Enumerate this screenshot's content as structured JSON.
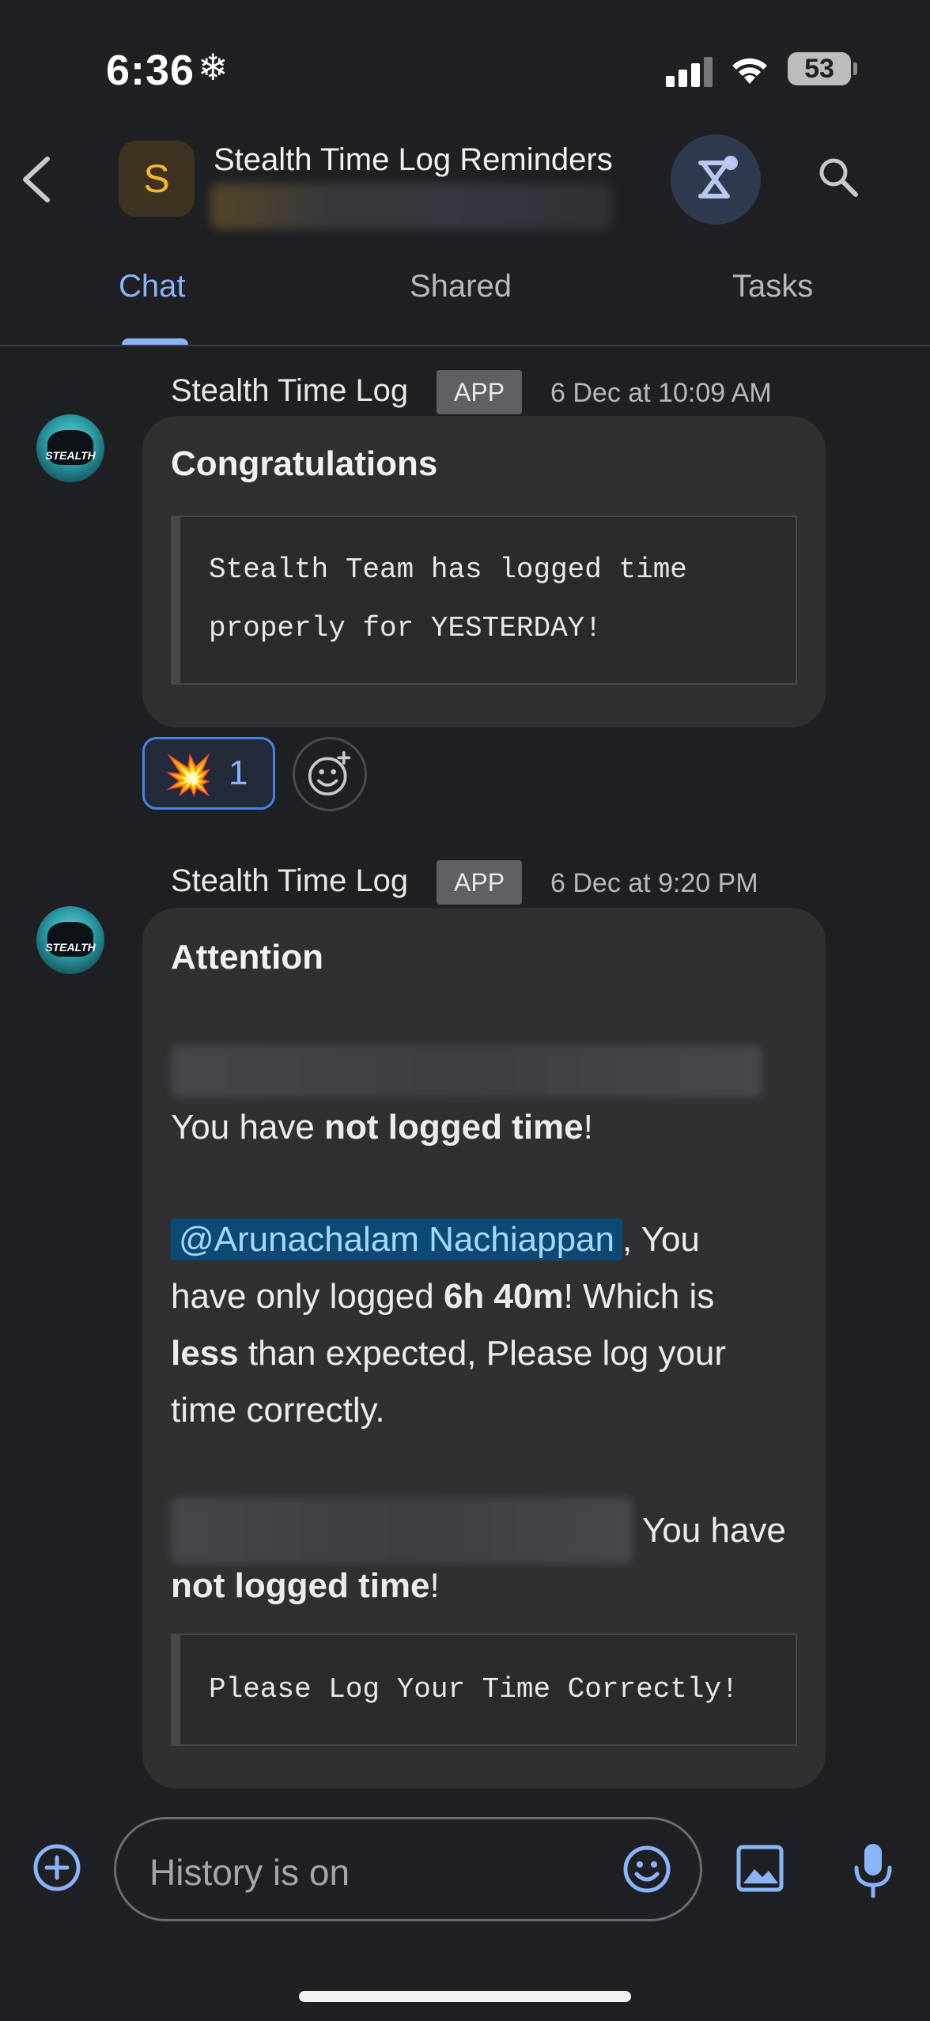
{
  "status_bar": {
    "time": "6:36",
    "weather_glyph": "❄",
    "battery": "53"
  },
  "header": {
    "space_initial": "S",
    "title": "Stealth Time Log Reminders",
    "back_icon": "chevron-left-icon",
    "app_icon": "integration-icon",
    "search_icon": "search-icon"
  },
  "tabs": [
    {
      "label": "Chat",
      "active": true
    },
    {
      "label": "Shared",
      "active": false
    },
    {
      "label": "Tasks",
      "active": false
    }
  ],
  "messages": [
    {
      "sender": "Stealth Time Log",
      "badge": "APP",
      "timestamp": "6 Dec at 10:09 AM",
      "avatar_text": "STEALTH",
      "title": "Congratulations",
      "code_lines": [
        "Stealth Team has logged time",
        "properly for YESTERDAY!"
      ],
      "reaction": {
        "emoji": "💥",
        "count": "1"
      }
    },
    {
      "sender": "Stealth Time Log",
      "badge": "APP",
      "timestamp": "6 Dec at 9:20 PM",
      "avatar_text": "STEALTH",
      "title": "Attention",
      "line1_prefix": "You have ",
      "line1_bold": "not logged time",
      "line1_suffix": "!",
      "mention": "@Arunachalam Nachiappan",
      "mention_suffix": ", You",
      "p2_a": "have only logged ",
      "p2_b": "6h 40m",
      "p2_c": "! Which is",
      "p2_d": "less",
      "p2_e": " than expected, Please log your",
      "p2_f": "time correctly.",
      "p3_a": "You have",
      "p3_b": "not logged time",
      "p3_c": "!",
      "code": "Please Log Your Time Correctly!"
    }
  ],
  "composer": {
    "placeholder": "History is on"
  },
  "colors": {
    "background": "#1f2023",
    "accent": "#8ab4f8",
    "card": "#303033"
  }
}
